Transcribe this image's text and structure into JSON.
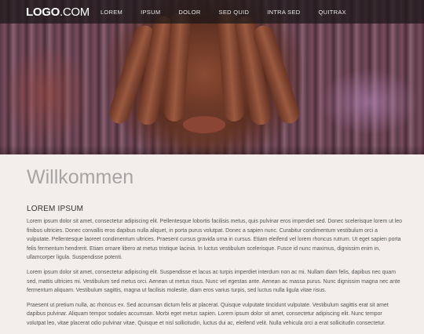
{
  "nav": {
    "logo_strong": "LOGO",
    "logo_rest": ".COM",
    "items": [
      "LOREM",
      "IPSUM",
      "DOLOR",
      "SED QUID",
      "INTRA SED",
      "QUITRAX"
    ]
  },
  "hero": {
    "image": "hands-over-face-photo"
  },
  "content": {
    "welcome": "Willkommen",
    "section_title": "LOREM IPSUM",
    "paragraphs": [
      "Lorem ipsum dolor sit amet, consectetur adipiscing elit. Pellentesque lobortis facilisis metus, quis pulvinar eros imperdiet sed. Donec scelerisque lorem ut leo finibus ultricies. Donec convallis eros dapibus nulla aliquet, in porta purus volutpat. Donec a sapien nunc. Curabitur condimentum vestibulum orci a vulputate. Pellentesque laoreet condimentum ultrices. Praesent cursus gravida urna in cursus. Etiam eleifend vel lorem rhoncus rutrum. Ut eget sapien porta felis fermentum hendrerit. Etiam ornare libero at metus tristique lacinia. In luctus vestibulum scelerisque. Fusce id nunc maximus, dignissim enim in, ullamcorper ligula. Suspendisse potenti.",
      "Lorem ipsum dolor sit amet, consectetur adipiscing elit. Suspendisse et lacus ac turpis imperdiet interdum non ac mi. Nullam diam felis, dapibus nec quam sed, mattis ultricies mi. Vestibulum sed metus orci. Aenean ut metus risus. Nunc vel egestas ante. Aenean ac massa purus. Nunc dignissim magna nec ante fermentum aliquam. Vestibulum sagittis, magna ut facilisis molestie, diam eros varius turpis, sed luctus nulla ligula vitae risus.",
      "Praesent ut pretium nulla, ac rhoncus ex. Sed accumsan dictum felis at placerat. Quisque vulputate tincidunt vulputate. Vestibulum sagittis erat sit amet dapibus pulvinar. Aliquam tempor sodales accumsan. Morbi eget metus sapien. Lorem ipsum dolor sit amet, consectetur adipiscing elit. Nunc tempor volutpat leo, vitae placerat odio pulvinar vitae. Quisque et nisl sollicitudin, luctus dui ac, eleifend velit. Nulla vehicula orci a erat sollicitudin consectetur."
    ]
  }
}
